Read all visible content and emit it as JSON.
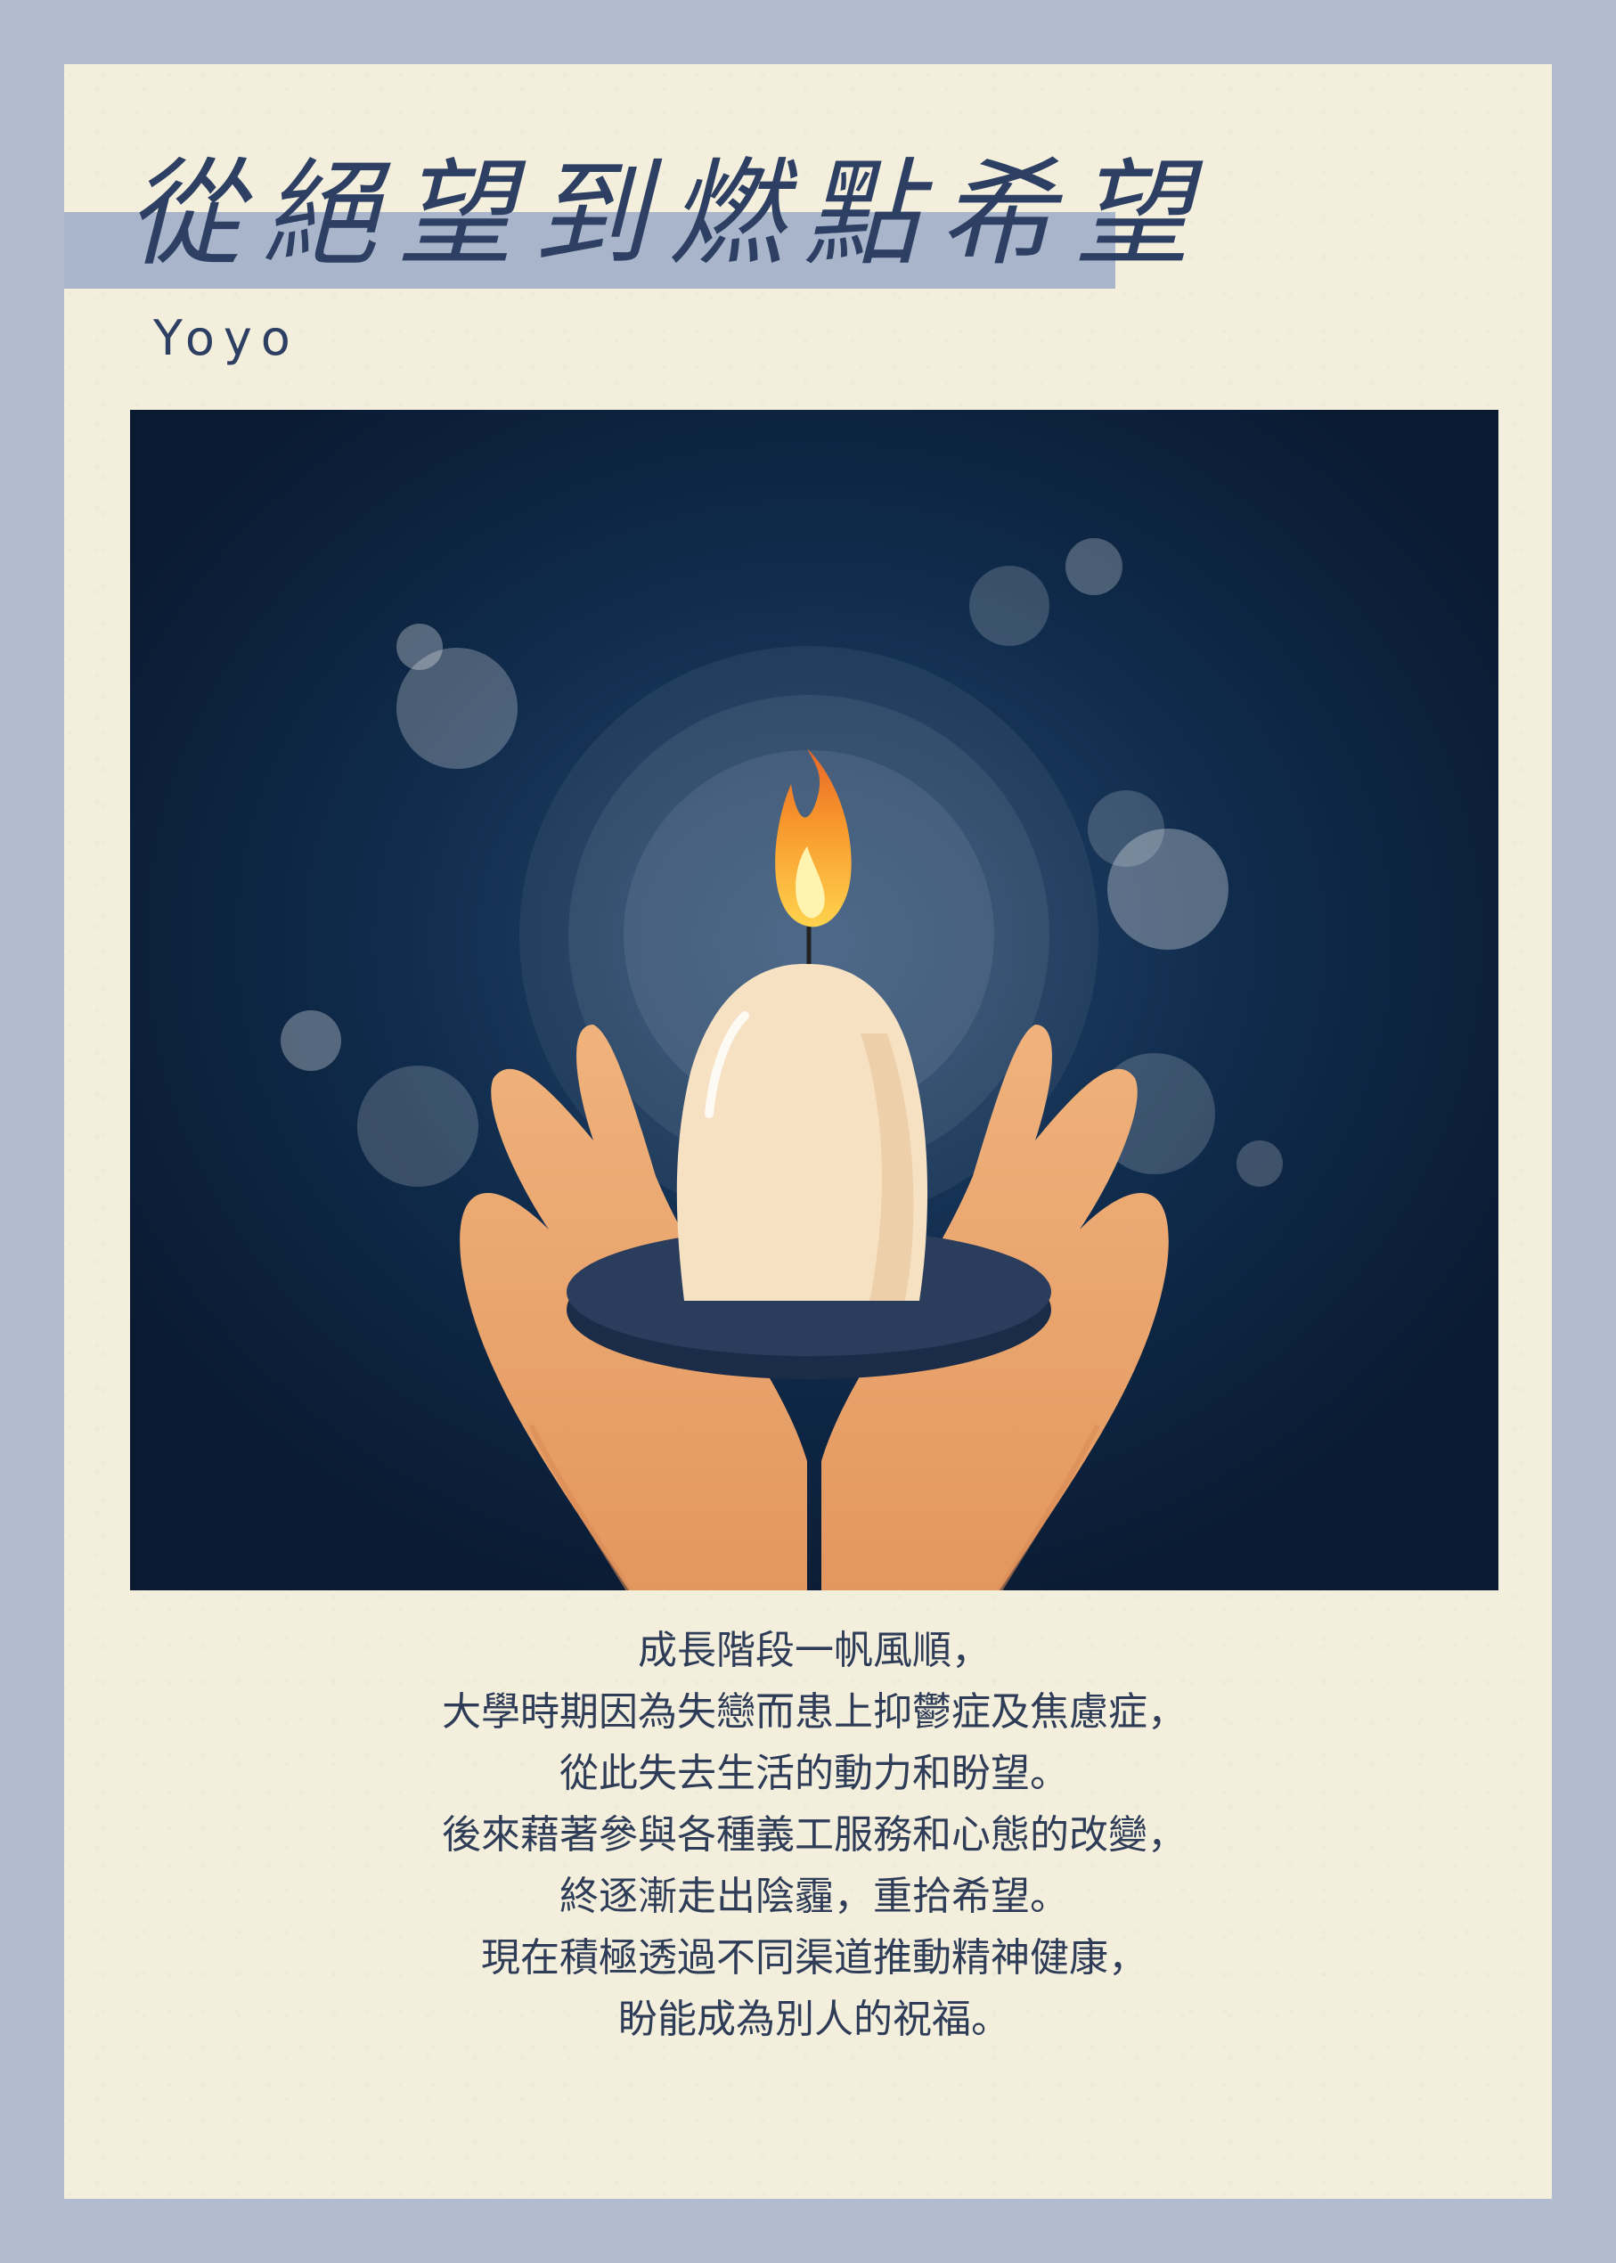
{
  "poster": {
    "title": "從絕望到燃點希望",
    "author": "Yoyo",
    "illustration_icon": "candle-in-hands-icon",
    "lines": [
      "成長階段一帆風順，",
      "大學時期因為失戀而患上抑鬱症及焦慮症，",
      "從此失去生活的動力和盼望。",
      "後來藉著參與各種義工服務和心態的改變，",
      "終逐漸走出陰霾，重拾希望。",
      "現在積極透過不同渠道推動精神健康，",
      "盼能成為別人的祝福。"
    ]
  },
  "colors": {
    "frame": "#b1bcd0",
    "paper": "#f3efdc",
    "title_band": "#a9b5cb",
    "ink": "#2d3f63",
    "illustration_bg": "#0b1d36"
  }
}
